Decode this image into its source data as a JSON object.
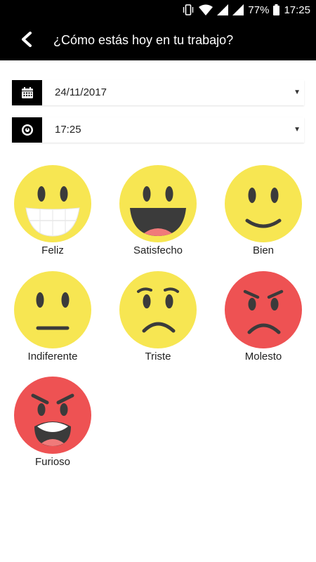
{
  "status_bar": {
    "battery": "77%",
    "time": "17:25",
    "icons": [
      "vibrate-icon",
      "wifi-icon",
      "signal-icon",
      "signal-icon",
      "battery-icon"
    ]
  },
  "header": {
    "title": "¿Cómo estás hoy en tu trabajo?",
    "back_icon": "chevron-left-icon"
  },
  "form": {
    "date": {
      "icon": "calendar-icon",
      "value": "24/11/2017",
      "caret": "▼"
    },
    "time": {
      "icon": "clock-icon",
      "value": "17:25",
      "caret": "▼"
    }
  },
  "colors": {
    "yellow_face": "#F7E652",
    "red_face": "#EE5253",
    "feature": "#3B3B3B",
    "teeth": "#FFFFFF",
    "tongue": "#F07A7A"
  },
  "moods": [
    {
      "label": "Feliz",
      "icon": "grin-face-icon"
    },
    {
      "label": "Satisfecho",
      "icon": "laughing-face-icon"
    },
    {
      "label": "Bien",
      "icon": "smile-face-icon"
    },
    {
      "label": "Indiferente",
      "icon": "neutral-face-icon"
    },
    {
      "label": "Triste",
      "icon": "sad-face-icon"
    },
    {
      "label": "Molesto",
      "icon": "annoyed-face-icon"
    },
    {
      "label": "Furioso",
      "icon": "furious-face-icon"
    }
  ]
}
